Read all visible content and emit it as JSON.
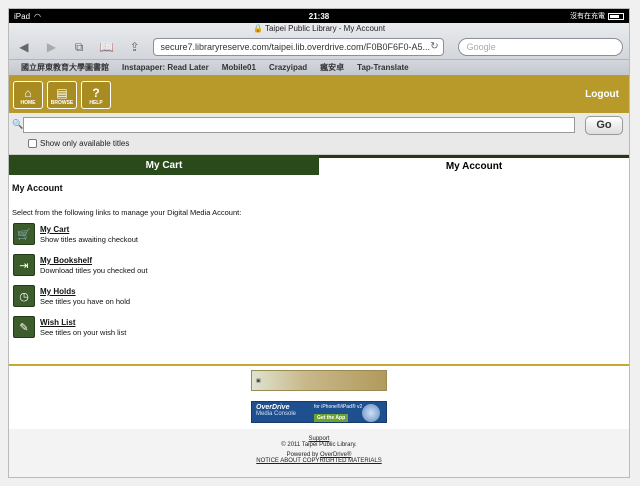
{
  "status": {
    "device": "iPad",
    "time": "21:38",
    "charging": "沒有在充電"
  },
  "browser": {
    "title": "Taipei Public Library - My Account",
    "url": "secure7.libraryreserve.com/taipei.lib.overdrive.com/F0B0F6F0-A5...",
    "search_placeholder": "Google",
    "bookmarks": [
      "國立屏東教育大學圖書館",
      "Instapaper: Read Later",
      "Mobile01",
      "Crazyipad",
      "瘋安卓",
      "Tap-Translate"
    ]
  },
  "header": {
    "home": "HOME",
    "browse": "BROWSE",
    "help": "HELP",
    "logout": "Logout"
  },
  "search": {
    "go": "Go",
    "available_only": "Show only available titles"
  },
  "tabs": {
    "cart": "My Cart",
    "account": "My Account"
  },
  "main": {
    "heading": "My Account",
    "intro": "Select from the following links to manage your Digital Media Account:",
    "links": [
      {
        "title": "My Cart",
        "desc": "Show titles awaiting checkout"
      },
      {
        "title": "My Bookshelf",
        "desc": "Download titles you checked out"
      },
      {
        "title": "My Holds",
        "desc": "See titles you have on hold"
      },
      {
        "title": "Wish List",
        "desc": "See titles on your wish list"
      }
    ]
  },
  "banners": {
    "overdrive": "OverDrive",
    "console": "Media Console",
    "platforms": "for iPhone®/iPad® v2",
    "get_app": "Get the App"
  },
  "footer": {
    "support": "Support",
    "copyright": "© 2011 Taipei Public Library.",
    "powered_prefix": "Powered by",
    "powered_link": "OverDrive®",
    "notice": "NOTICE ABOUT COPYRIGHTED MATERIALS"
  }
}
